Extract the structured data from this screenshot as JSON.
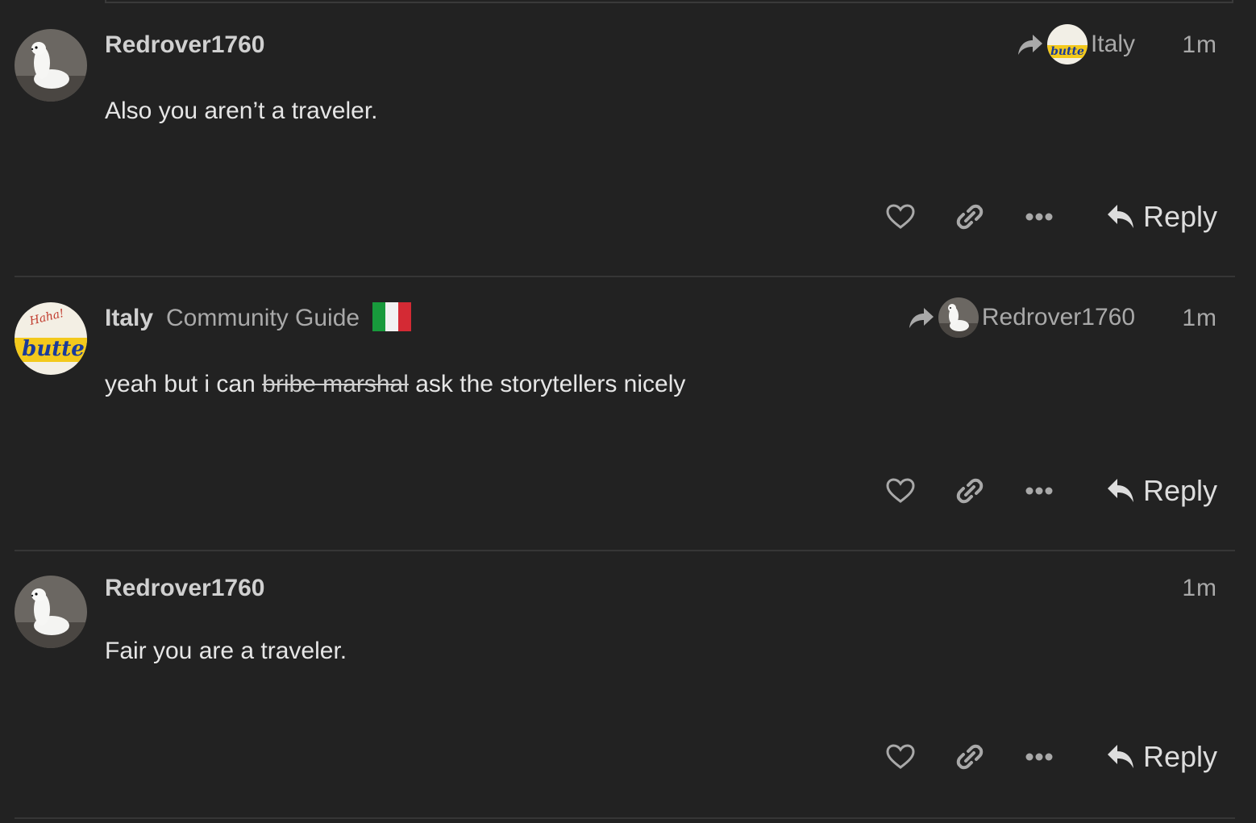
{
  "posts": [
    {
      "username": "Redrover1760",
      "user_title": "",
      "reply_to": "Italy",
      "time": "1m",
      "body_plain": "Also you aren’t a traveler.",
      "reply_label": "Reply"
    },
    {
      "username": "Italy",
      "user_title": "Community Guide",
      "reply_to": "Redrover1760",
      "time": "1m",
      "body_before": "yeah but i can ",
      "body_struck": "bribe marshal",
      "body_after": " ask the storytellers nicely",
      "reply_label": "Reply"
    },
    {
      "username": "Redrover1760",
      "user_title": "",
      "time": "1m",
      "body_plain": "Fair you are a traveler.",
      "reply_label": "Reply"
    }
  ],
  "avatar_text": {
    "haha": "Haha!",
    "butte": "butte"
  },
  "colors": {
    "background": "#222222",
    "flag_green": "#189a3c",
    "flag_white": "#f2f2f2",
    "flag_red": "#d42a34"
  },
  "icons": [
    "reply-arrow-icon",
    "heart-icon",
    "link-icon",
    "ellipsis-icon",
    "reply-icon"
  ]
}
